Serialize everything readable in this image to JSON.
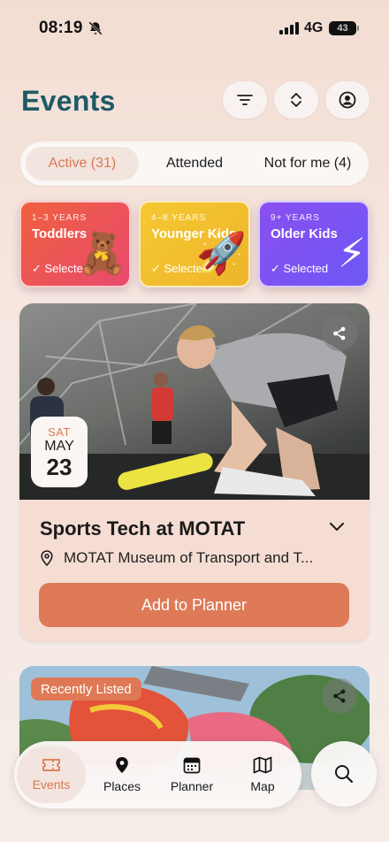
{
  "status_bar": {
    "time": "08:19",
    "network": "4G",
    "battery": "43"
  },
  "header": {
    "title": "Events",
    "filter_icon": "filter-lines-icon",
    "sort_icon": "chevron-up-down-icon",
    "profile_icon": "user-circle-icon"
  },
  "tabs": [
    {
      "label": "Active (31)",
      "active": true
    },
    {
      "label": "Attended",
      "active": false
    },
    {
      "label": "Not for me (4)",
      "active": false
    }
  ],
  "age_groups": [
    {
      "range": "1–3 YEARS",
      "name": "Toddlers",
      "selected_label": "✓ Selected",
      "emoji": "🧸",
      "color": "#ec4f66"
    },
    {
      "range": "4–8 YEARS",
      "name": "Younger Kids",
      "selected_label": "✓ Selected",
      "emoji": "🚀",
      "color": "#f2c12e"
    },
    {
      "range": "9+ YEARS",
      "name": "Older Kids",
      "selected_label": "✓ Selected",
      "emoji": "⚡",
      "color": "#7a52f4"
    }
  ],
  "event": {
    "date": {
      "dow": "SAT",
      "month": "MAY",
      "day": "23"
    },
    "title": "Sports Tech at MOTAT",
    "location": "MOTAT Museum of Transport and T...",
    "cta": "Add to Planner",
    "share_icon": "share-icon"
  },
  "event2": {
    "badge": "Recently Listed"
  },
  "nav": [
    {
      "label": "Events",
      "icon": "ticket-icon",
      "active": true
    },
    {
      "label": "Places",
      "icon": "map-pin-icon",
      "active": false
    },
    {
      "label": "Planner",
      "icon": "calendar-icon",
      "active": false
    },
    {
      "label": "Map",
      "icon": "map-icon",
      "active": false
    }
  ],
  "search_icon": "search-icon",
  "colors": {
    "accent": "#d97852",
    "title": "#1d5a66",
    "button": "#de7a57"
  }
}
